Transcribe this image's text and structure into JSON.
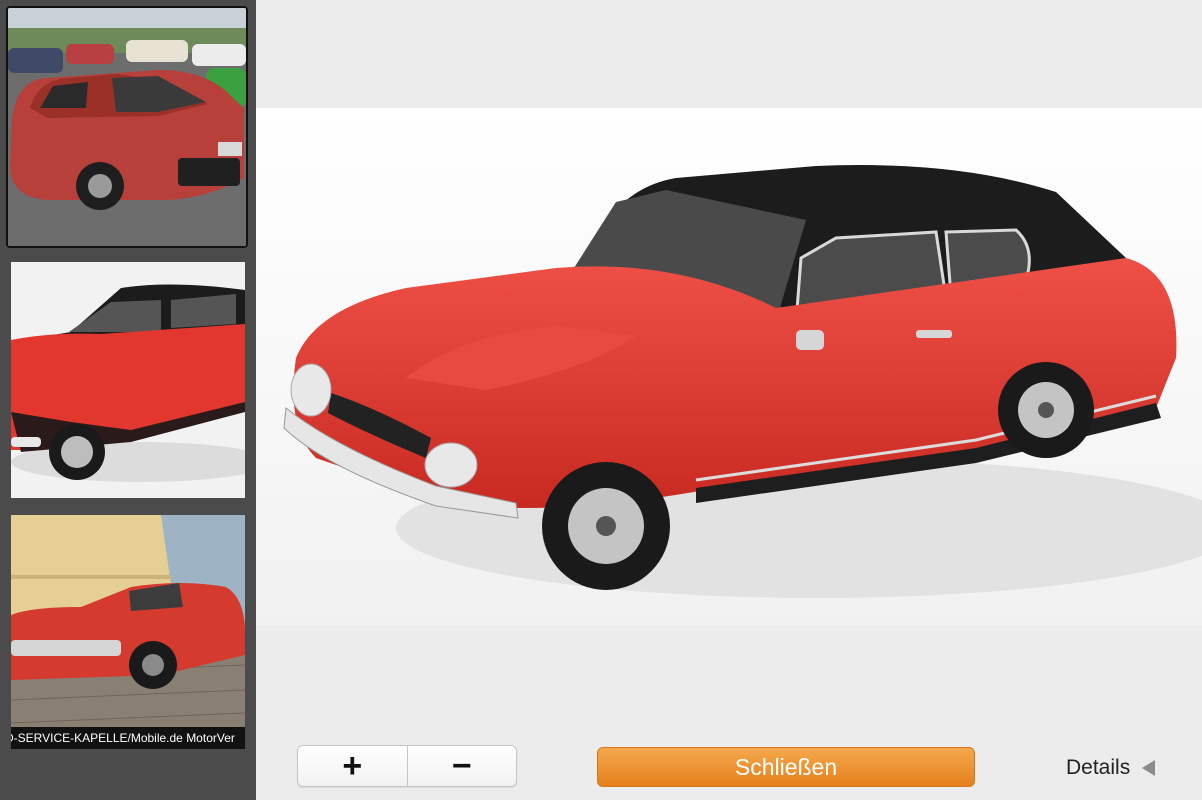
{
  "thumbnails": [
    {
      "name": "red coupe rear view photo",
      "selected": true
    },
    {
      "name": "red coupe model front view",
      "selected": false
    },
    {
      "name": "red coupe parked outdoors",
      "selected": false,
      "watermark": "D-SERVICE-KAPELLE/Mobile.de MotorVer"
    }
  ],
  "controls": {
    "zoom_in_label": "+",
    "zoom_out_label": "−",
    "close_label": "Schließen",
    "details_label": "Details"
  },
  "colors": {
    "accent": "#e88a26",
    "car_red": "#e2372f",
    "roof_black": "#1c1c1c",
    "sidebar": "#4b4b4b"
  }
}
